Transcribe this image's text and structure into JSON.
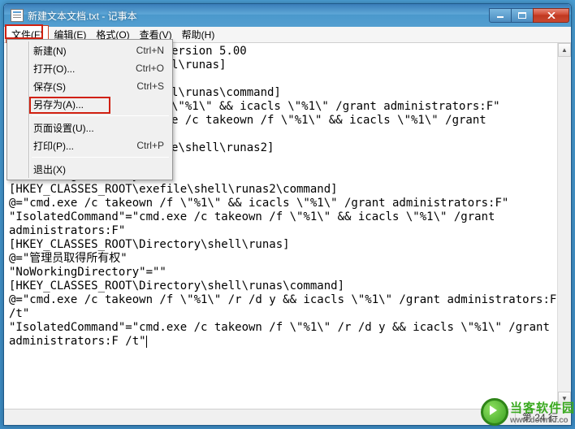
{
  "window": {
    "title": "新建文本文档.txt - 记事本"
  },
  "menubar": {
    "file": "文件(F)",
    "edit": "编辑(E)",
    "format": "格式(O)",
    "view": "查看(V)",
    "help": "帮助(H)"
  },
  "file_menu": {
    "new": {
      "label": "新建(N)",
      "shortcut": "Ctrl+N"
    },
    "open": {
      "label": "打开(O)...",
      "shortcut": "Ctrl+O"
    },
    "save": {
      "label": "保存(S)",
      "shortcut": "Ctrl+S"
    },
    "saveas": {
      "label": "另存为(A)...",
      "shortcut": ""
    },
    "page_setup": {
      "label": "页面设置(U)...",
      "shortcut": ""
    },
    "print": {
      "label": "打印(P)...",
      "shortcut": "Ctrl+P"
    },
    "exit": {
      "label": "退出(X)",
      "shortcut": ""
    }
  },
  "editor": {
    "visible_fragments": {
      "l1": "ersion 5.00",
      "l2": "l\\runas]",
      "l3": "l\\runas\\command]",
      "l4": "\\\"%1\\\" && icacls \\\"%1\\\" /grant administrators:F\"",
      "l5": "e /c takeown /f \\\"%1\\\" && icacls \\\"%1\\\" /grant",
      "l6": "e\\shell\\runas2]"
    },
    "body": "\"NoWorkingDirectory\"=\"\"\n[HKEY_CLASSES_ROOT\\exefile\\shell\\runas2\\command]\n@=\"cmd.exe /c takeown /f \\\"%1\\\" && icacls \\\"%1\\\" /grant administrators:F\"\n\"IsolatedCommand\"=\"cmd.exe /c takeown /f \\\"%1\\\" && icacls \\\"%1\\\" /grant\nadministrators:F\"\n[HKEY_CLASSES_ROOT\\Directory\\shell\\runas]\n@=\"管理员取得所有权\"\n\"NoWorkingDirectory\"=\"\"\n[HKEY_CLASSES_ROOT\\Directory\\shell\\runas\\command]\n@=\"cmd.exe /c takeown /f \\\"%1\\\" /r /d y && icacls \\\"%1\\\" /grant administrators:F\n/t\"\n\"IsolatedCommand\"=\"cmd.exe /c takeown /f \\\"%1\\\" /r /d y && icacls \\\"%1\\\" /grant\nadministrators:F /t\""
  },
  "statusbar": {
    "pos": "第 24 行"
  },
  "watermark": {
    "cn": "当客软件园",
    "en": "www.downkr.co"
  }
}
